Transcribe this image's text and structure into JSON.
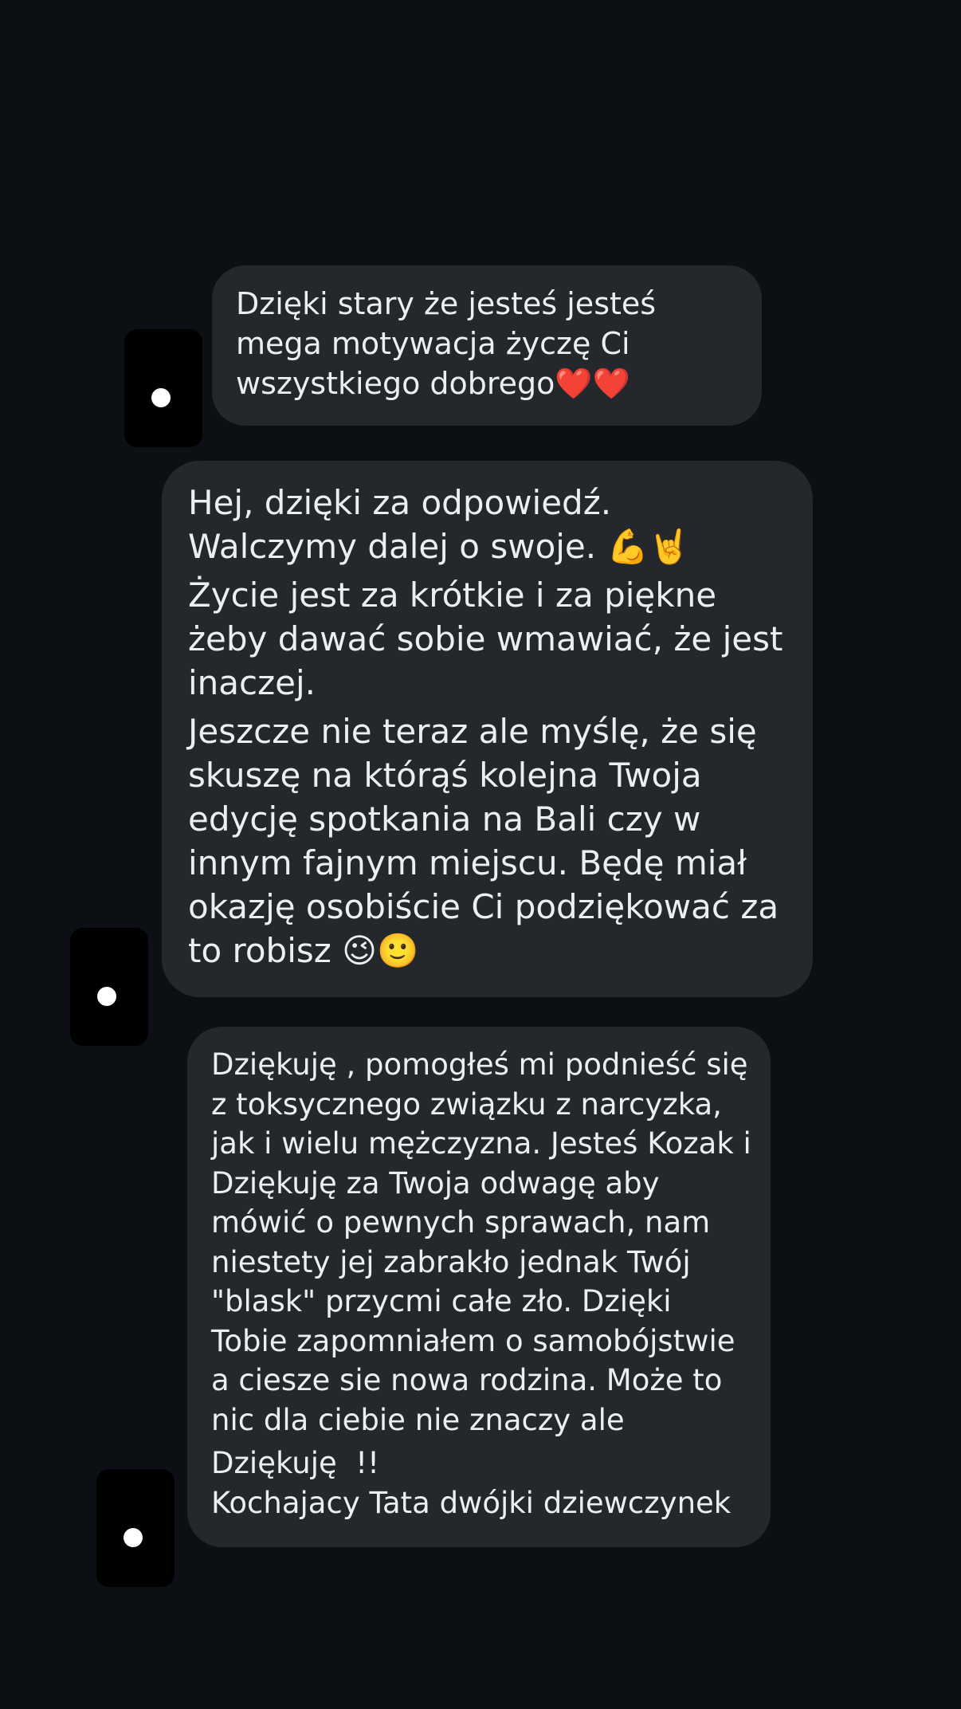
{
  "messages": [
    {
      "paragraphs": [
        "Dzięki stary że jesteś jesteś mega motywacja życzę Ci wszystkiego dobrego❤️❤️"
      ]
    },
    {
      "paragraphs": [
        "Hej, dzięki za odpowiedź. Walczymy dalej o swoje. 💪🤘",
        "Życie jest za krótkie i za piękne żeby dawać sobie wmawiać, że jest inaczej.",
        "Jeszcze nie teraz ale myślę, że się skuszę na którąś kolejna Twoja edycję spotkania na Bali czy w innym fajnym miejscu. Będę miał okazję osobiście Ci podziękować za to robisz 😉🙂"
      ]
    },
    {
      "paragraphs": [
        "Dziękuję , pomogłeś mi podnieść się z toksycznego związku z narcyzka, jak i wielu mężczyzna. Jesteś Kozak i Dziękuję za Twoja odwagę aby mówić o pewnych sprawach, nam niestety jej zabrakło jednak Twój \"blask\" przycmi całe zło. Dzięki Tobie zapomniałem o samobójstwie a ciesze sie nowa rodzina. Może to nic dla ciebie nie znaczy ale",
        "Dziękuję  !!",
        "Kochajacy Tata dwójki dziewczynek"
      ]
    }
  ]
}
